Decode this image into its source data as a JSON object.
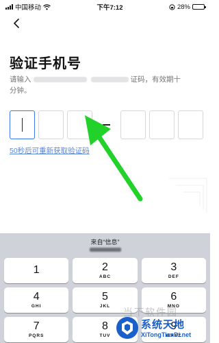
{
  "status_bar": {
    "carrier": "中国移动",
    "time": "下午7:12",
    "battery": "28%",
    "battery_level": 0.28
  },
  "page": {
    "title": "验证手机号",
    "description_start": "请输入",
    "description_mid": "证码，有效期十",
    "description_end": "分钟。",
    "resend": "50秒后可重新获取验证码"
  },
  "code_inputs": {
    "digits": [
      "",
      "",
      "",
      "",
      "",
      ""
    ],
    "separator": "-"
  },
  "keyboard": {
    "suggestion": "来自“信息”",
    "rows": [
      [
        {
          "num": "1",
          "sub": ""
        },
        {
          "num": "2",
          "sub": "ABC"
        },
        {
          "num": "3",
          "sub": "DEF"
        }
      ],
      [
        {
          "num": "4",
          "sub": "GHI"
        },
        {
          "num": "5",
          "sub": "JKL"
        },
        {
          "num": "6",
          "sub": "MNO"
        }
      ],
      [
        {
          "num": "7",
          "sub": "PQRS"
        },
        {
          "num": "8",
          "sub": "TUV"
        },
        {
          "num": "9",
          "sub": "WXYZ"
        }
      ]
    ]
  },
  "watermark": {
    "name": "系统天地",
    "url": "XiTongTianDi.net",
    "faded_text": "当下软件园"
  },
  "colors": {
    "accent": "#3c74f0",
    "link": "#5b86d8",
    "arrow": "#22d12a",
    "keyboard_bg": "#cfd3d9",
    "brand": "#1b5fc9"
  }
}
